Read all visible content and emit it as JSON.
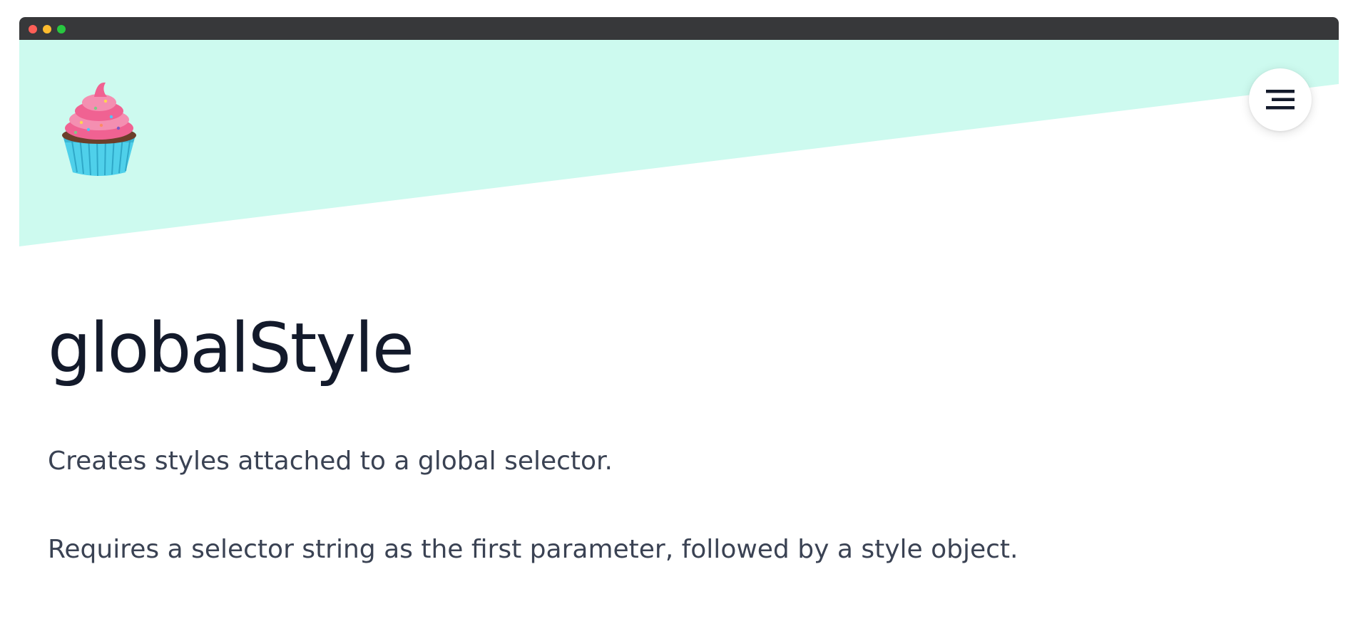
{
  "window": {
    "controls": [
      "close",
      "minimize",
      "maximize"
    ],
    "colors": {
      "titlebar": "#37383a",
      "close": "#fe5f57",
      "minimize": "#febc2e",
      "maximize": "#28c840"
    }
  },
  "header": {
    "background_color": "#cdfaef",
    "logo_icon": "cupcake-icon",
    "menu_icon": "menu-icon"
  },
  "main": {
    "title": "globalStyle",
    "paragraphs": [
      "Creates styles attached to a global selector.",
      "Requires a selector string as the first parameter, followed by a style object."
    ]
  }
}
